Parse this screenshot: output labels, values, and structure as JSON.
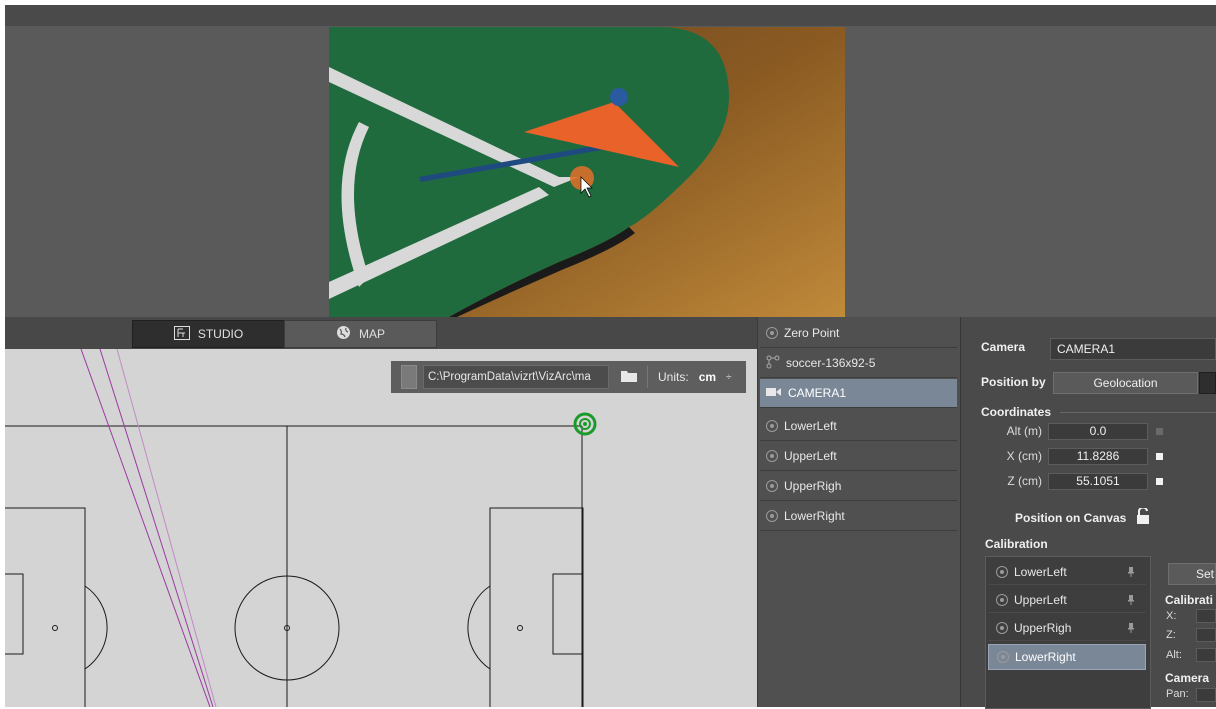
{
  "tabs": {
    "studio": "STUDIO",
    "map": "MAP"
  },
  "map_toolbar": {
    "path": "C:\\ProgramData\\vizrt\\VizArc\\ma",
    "units_label": "Units:",
    "units_value": "cm"
  },
  "scene_list": [
    {
      "label": "Zero Point",
      "icon": "target-icon",
      "selected": false
    },
    {
      "label": "soccer-136x92-5",
      "icon": "node-icon",
      "selected": false
    },
    {
      "label": "CAMERA1",
      "icon": "camera-icon",
      "selected": true
    },
    {
      "label": "LowerLeft",
      "icon": "target-icon",
      "selected": false
    },
    {
      "label": "UpperLeft",
      "icon": "target-icon",
      "selected": false
    },
    {
      "label": "UpperRigh",
      "icon": "target-icon",
      "selected": false
    },
    {
      "label": "LowerRight",
      "icon": "target-icon",
      "selected": false
    }
  ],
  "properties": {
    "camera_label": "Camera",
    "camera_value": "CAMERA1",
    "position_by_label": "Position by",
    "position_by_value": "Geolocation",
    "coordinates_label": "Coordinates",
    "alt_label": "Alt  (m)",
    "alt_value": "0.0",
    "x_label": "X (cm)",
    "x_value": "11.8286",
    "z_label": "Z (cm)",
    "z_value": "55.1051",
    "position_on_canvas": "Position on Canvas"
  },
  "calibration": {
    "label": "Calibration",
    "items": [
      {
        "label": "LowerLeft",
        "selected": false
      },
      {
        "label": "UpperLeft",
        "selected": false
      },
      {
        "label": "UpperRigh",
        "selected": false
      },
      {
        "label": "LowerRight",
        "selected": true
      }
    ],
    "set_button": "Set",
    "calibration_heading": "Calibrati",
    "x_label": "X:",
    "z_label": "Z:",
    "alt_label": "Alt:",
    "camera_heading": "Camera",
    "pan_label": "Pan:"
  },
  "colors": {
    "selection": "#7a8796",
    "panel": "#4a4a4a",
    "map_bg": "#d4d4d4",
    "camera_marker": "#1a9a2a",
    "sightline": "#9a3aa0"
  }
}
